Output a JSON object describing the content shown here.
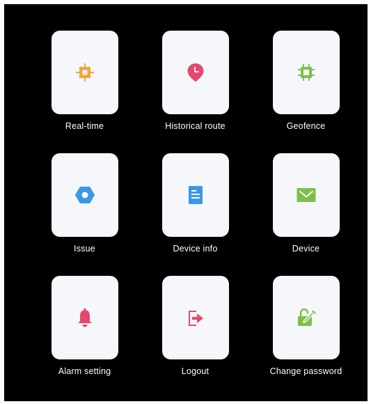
{
  "menu": {
    "items": [
      {
        "label": "Real-time",
        "icon": "realtime-chip-icon",
        "color": "#f5a33c"
      },
      {
        "label": "Historical route",
        "icon": "location-clock-pin-icon",
        "color": "#e6496e"
      },
      {
        "label": "Geofence",
        "icon": "geofence-chip-icon",
        "color": "#7cc04b"
      },
      {
        "label": "Issue",
        "icon": "hexagon-icon",
        "color": "#3a98e8"
      },
      {
        "label": "Device info",
        "icon": "document-icon",
        "color": "#3a98e8"
      },
      {
        "label": "Device",
        "icon": "envelope-icon",
        "color": "#7cc04b"
      },
      {
        "label": "Alarm setting",
        "icon": "bell-icon",
        "color": "#e6496e"
      },
      {
        "label": "Logout",
        "icon": "logout-icon",
        "color": "#e6496e"
      },
      {
        "label": "Change password",
        "icon": "unlock-edit-icon",
        "color": "#7cc04b"
      }
    ]
  }
}
